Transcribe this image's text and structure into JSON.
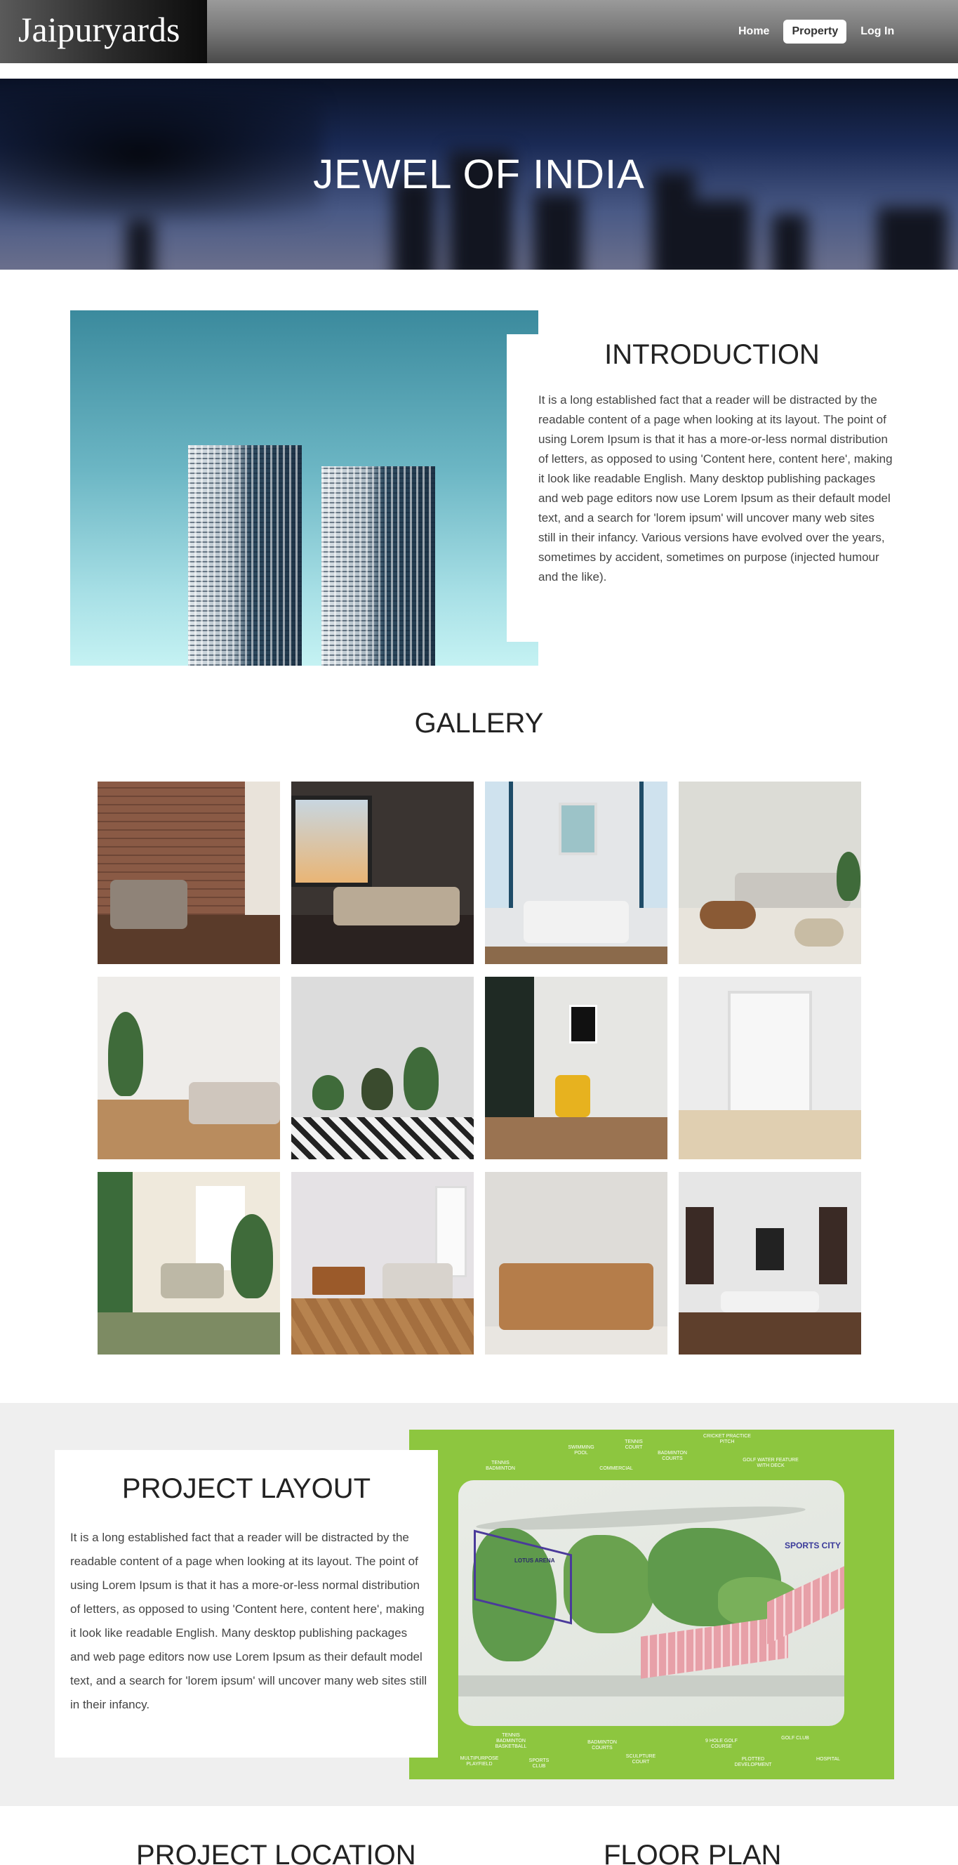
{
  "navbar": {
    "brand": "Jaipuryards",
    "links": [
      {
        "label": "Home"
      },
      {
        "label": "Property",
        "active": true
      },
      {
        "label": "Log In"
      }
    ]
  },
  "hero": {
    "title": "JEWEL OF INDIA"
  },
  "introduction": {
    "title": "INTRODUCTION",
    "body": "It is a long established fact that a reader will be distracted by the readable content of a page when looking at its layout. The point of using Lorem Ipsum is that it has a more-or-less normal distribution of letters, as opposed to using 'Content here, content here', making it look like readable English. Many desktop publishing packages and web page editors now use Lorem Ipsum as their default model text, and a search for 'lorem ipsum' will uncover many web sites still in their infancy. Various versions have evolved over the years, sometimes by accident, sometimes on purpose (injected humour and the like)."
  },
  "gallery": {
    "title": "GALLERY",
    "images": [
      {
        "alt": "living room with brick wall"
      },
      {
        "alt": "loft living room at dusk"
      },
      {
        "alt": "blue accented living room"
      },
      {
        "alt": "round wooden tables living room"
      },
      {
        "alt": "minimal room with plants"
      },
      {
        "alt": "room with potted plants and rug"
      },
      {
        "alt": "yellow armchair corner"
      },
      {
        "alt": "white double doors"
      },
      {
        "alt": "cozy green living room"
      },
      {
        "alt": "sunlit room with sideboard"
      },
      {
        "alt": "leather sofa"
      },
      {
        "alt": "grey classic living room"
      }
    ]
  },
  "project_layout": {
    "title": "PROJECT LAYOUT",
    "body": "It is a long established fact that a reader will be distracted by the readable content of a page when looking at its layout. The point of using Lorem Ipsum is that it has a more-or-less normal distribution of letters, as opposed to using 'Content here, content here', making it look like readable English. Many desktop publishing packages and web page editors now use Lorem Ipsum as their default model text, and a search for 'lorem ipsum' will uncover many web sites still in their infancy.",
    "map": {
      "brand": "SPORTS CITY",
      "arena": "LOTUS ARENA",
      "labels_top": [
        "TENNIS BADMINTON",
        "SWIMMING POOL",
        "COMMERCIAL",
        "TENNIS COURT",
        "BADMINTON COURTS",
        "CRICKET PRACTICE PITCH",
        "GOLF WATER FEATURE WITH DECK"
      ],
      "labels_bottom": [
        "MULTIPURPOSE PLAYFIELD",
        "TENNIS BADMINTON BASKETBALL",
        "SPORTS CLUB",
        "BADMINTON COURTS",
        "SCULPTURE COURT",
        "9 HOLE GOLF COURSE",
        "PLOTTED DEVELOPMENT",
        "GOLF CLUB",
        "HOSPITAL"
      ]
    }
  },
  "project_location": {
    "title": "PROJECT LOCATION"
  },
  "floor_plan": {
    "title": "FLOOR PLAN"
  }
}
